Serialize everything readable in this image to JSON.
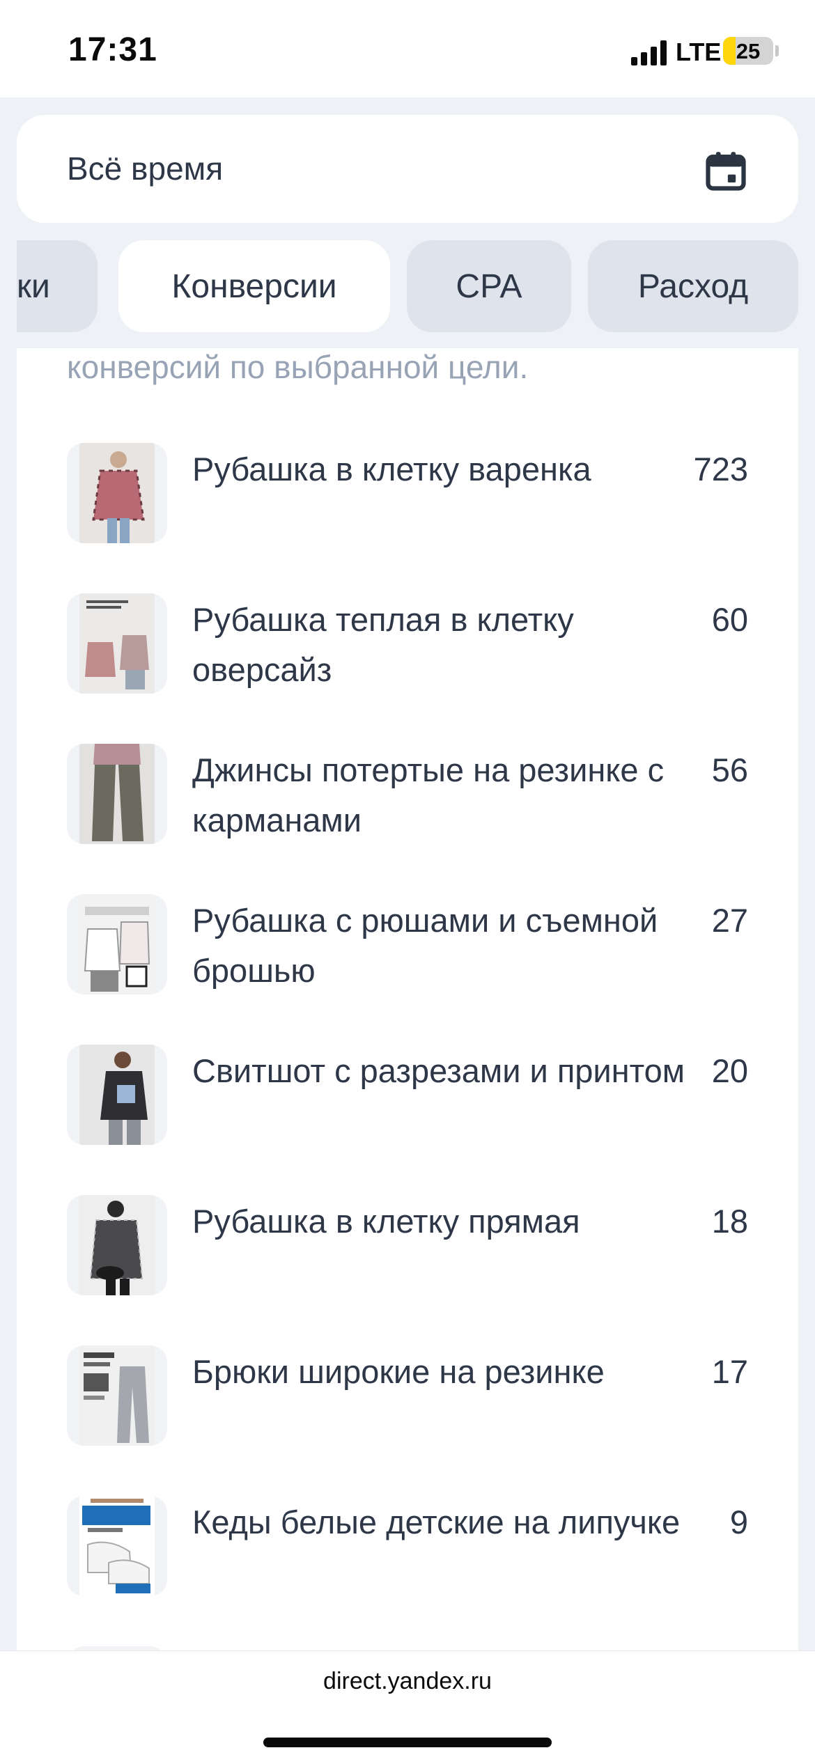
{
  "status_bar": {
    "time": "17:31",
    "network": "LTE",
    "battery": "25",
    "battery_level_percent": 25
  },
  "date_filter": {
    "label": "Всё время",
    "icon": "calendar-icon"
  },
  "metric_tabs": [
    {
      "label": "ки",
      "active": false
    },
    {
      "label": "Конверсии",
      "active": true
    },
    {
      "label": "CPA",
      "active": false
    },
    {
      "label": "Расход",
      "active": false
    }
  ],
  "list": {
    "hint": "конверсий по выбранной цели.",
    "items": [
      {
        "title": "Рубашка в клетку варенка",
        "value": "723"
      },
      {
        "title": "Рубашка теплая в клетку оверсайз",
        "value": "60"
      },
      {
        "title": "Джинсы потертые на резинке с карманами",
        "value": "56"
      },
      {
        "title": "Рубашка с рюшами и съемной брошью",
        "value": "27"
      },
      {
        "title": "Свитшот с разрезами и принтом",
        "value": "20"
      },
      {
        "title": "Рубашка в клетку прямая",
        "value": "18"
      },
      {
        "title": "Брюки широкие на резинке",
        "value": "17"
      },
      {
        "title": "Кеды белые детские на липучке",
        "value": "9"
      }
    ]
  },
  "browser": {
    "url": "direct.yandex.ru"
  },
  "colors": {
    "background": "#eef1f6",
    "card": "#ffffff",
    "tab_inactive": "#dfe4ec",
    "text": "#2d3748",
    "hint_text": "#98a4b6",
    "battery": "#ffd60a"
  }
}
